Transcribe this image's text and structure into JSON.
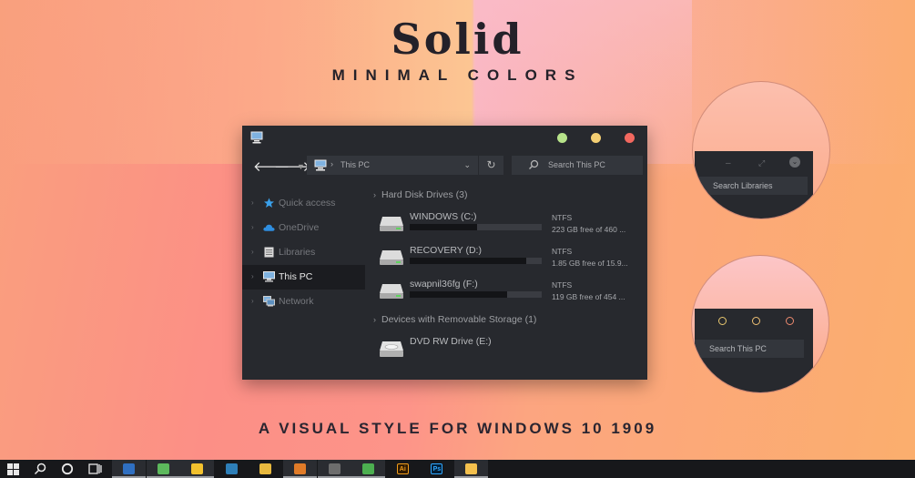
{
  "banner": {
    "title": "Solid",
    "subtitle": "MINIMAL COLORS",
    "tagline": "A VISUAL STYLE FOR WINDOWS 10 1909"
  },
  "explorer": {
    "address": "This PC",
    "search_placeholder": "Search This PC",
    "window_buttons": {
      "minimize_color": "#b7e38a",
      "maximize_color": "#f4cf73",
      "close_color": "#f2685f"
    },
    "sidebar": [
      {
        "label": "Quick access",
        "icon": "star-icon",
        "active": false
      },
      {
        "label": "OneDrive",
        "icon": "cloud-icon",
        "active": false
      },
      {
        "label": "Libraries",
        "icon": "library-icon",
        "active": false
      },
      {
        "label": "This PC",
        "icon": "computer-icon",
        "active": true
      },
      {
        "label": "Network",
        "icon": "network-icon",
        "active": false
      }
    ],
    "groups": [
      {
        "label": "Hard Disk Drives (3)"
      },
      {
        "label": "Devices with Removable Storage (1)"
      }
    ],
    "drives": [
      {
        "name": "WINDOWS (C:)",
        "fs": "NTFS",
        "free": "223 GB free of 460 ...",
        "used_fraction": 0.51
      },
      {
        "name": "RECOVERY (D:)",
        "fs": "NTFS",
        "free": "1.85 GB free of 15.9...",
        "used_fraction": 0.88
      },
      {
        "name": "swapnil36fg (F:)",
        "fs": "NTFS",
        "free": "119 GB free of 454 ...",
        "used_fraction": 0.74
      }
    ],
    "removable": [
      {
        "name": "DVD RW Drive (E:)"
      }
    ]
  },
  "zoom_previews": {
    "libraries_search": "Search Libraries",
    "thispc_search": "Search This PC",
    "ring_colors": [
      "#e9c86f",
      "#efc174",
      "#ee8b70"
    ]
  },
  "taskbar": {
    "apps": [
      {
        "name": "photos",
        "label": "",
        "color": "#2f6fc1"
      },
      {
        "name": "evernote",
        "label": "",
        "color": "#5cb85c"
      },
      {
        "name": "sticky",
        "label": "",
        "color": "#f2c12e"
      },
      {
        "name": "excel",
        "label": "",
        "color": "#2e7fb8"
      },
      {
        "name": "folder",
        "label": "",
        "color": "#e8b93f"
      },
      {
        "name": "firefox",
        "label": "",
        "color": "#e07b28"
      },
      {
        "name": "video",
        "label": "",
        "color": "#6d6d6d"
      },
      {
        "name": "spotify",
        "label": "",
        "color": "#4caf50"
      },
      {
        "name": "illustrator",
        "label": "Ai",
        "color": "#f29d1b"
      },
      {
        "name": "photoshop",
        "label": "Ps",
        "color": "#31a8ff"
      },
      {
        "name": "explorer",
        "label": "",
        "color": "#f4c04d"
      }
    ]
  }
}
